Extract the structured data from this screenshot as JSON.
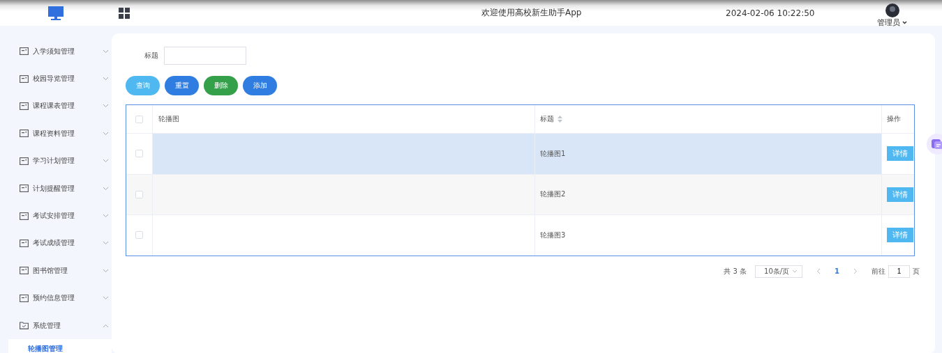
{
  "header": {
    "welcome": "欢迎使用高校新生助手App",
    "datetime": "2024-02-06 10:22:50",
    "user": "管理员"
  },
  "sidebar": {
    "items": [
      {
        "label": "入学须知管理",
        "kind": "module",
        "expanded": false
      },
      {
        "label": "校园导览管理",
        "kind": "module",
        "expanded": false
      },
      {
        "label": "课程课表管理",
        "kind": "module",
        "expanded": false
      },
      {
        "label": "课程资料管理",
        "kind": "module",
        "expanded": false
      },
      {
        "label": "学习计划管理",
        "kind": "module",
        "expanded": false
      },
      {
        "label": "计划提醒管理",
        "kind": "module",
        "expanded": false
      },
      {
        "label": "考试安排管理",
        "kind": "module",
        "expanded": false
      },
      {
        "label": "考试成绩管理",
        "kind": "module",
        "expanded": false
      },
      {
        "label": "图书馆管理",
        "kind": "module",
        "expanded": false
      },
      {
        "label": "预约信息管理",
        "kind": "module",
        "expanded": false
      },
      {
        "label": "系统管理",
        "kind": "folder",
        "expanded": true,
        "children": [
          {
            "label": "轮播图管理",
            "selected": true
          }
        ]
      }
    ]
  },
  "search": {
    "label": "标题"
  },
  "buttons": [
    {
      "label": "查询",
      "color": "#4fb8f0"
    },
    {
      "label": "重置",
      "color": "#2f7de1"
    },
    {
      "label": "删除",
      "color": "#34a04a"
    },
    {
      "label": "添加",
      "color": "#2f7de1"
    }
  ],
  "table": {
    "columns": [
      "轮播图",
      "标题",
      "操作"
    ],
    "all_checked": false,
    "rows": [
      {
        "checked": false,
        "hovered": true,
        "title": "轮播图1",
        "action": "详情"
      },
      {
        "checked": false,
        "hovered": false,
        "title": "轮播图2",
        "action": "详情"
      },
      {
        "checked": false,
        "hovered": false,
        "title": "轮播图3",
        "action": "详情"
      }
    ]
  },
  "pagination": {
    "total": "共 3 条",
    "page_size": "10条/页",
    "current": "1",
    "goto_label": "前往",
    "goto_value": "1",
    "goto_suffix": "页"
  }
}
